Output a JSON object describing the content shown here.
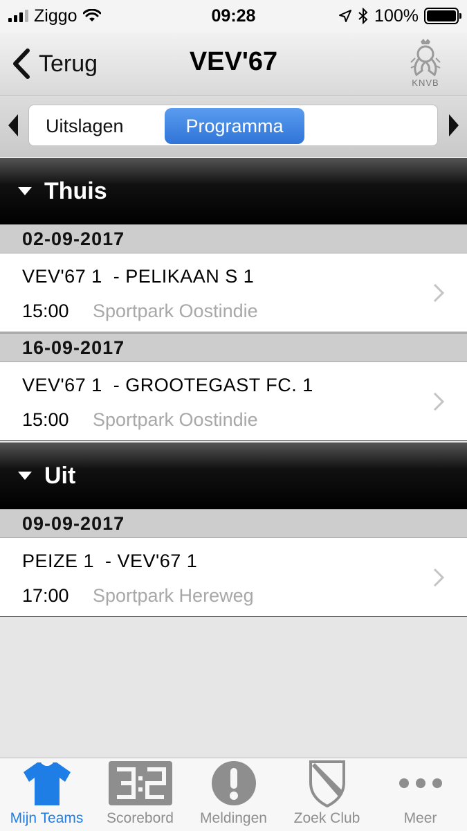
{
  "status": {
    "carrier": "Ziggo",
    "time": "09:28",
    "battery": "100%"
  },
  "nav": {
    "back_label": "Terug",
    "title": "VEV'67",
    "logo_text": "KNVB"
  },
  "segments": {
    "items": [
      "Uitslagen",
      "Programma"
    ],
    "selected": "Programma"
  },
  "sections": [
    {
      "title": "Thuis",
      "groups": [
        {
          "date": "02-09-2017",
          "match": "VEV'67 1  - PELIKAAN S 1",
          "time": "15:00",
          "venue": "Sportpark Oostindie"
        },
        {
          "date": "16-09-2017",
          "match": "VEV'67 1  - GROOTEGAST FC. 1",
          "time": "15:00",
          "venue": "Sportpark Oostindie"
        }
      ]
    },
    {
      "title": "Uit",
      "groups": [
        {
          "date": "09-09-2017",
          "match": "PEIZE 1  - VEV'67 1",
          "time": "17:00",
          "venue": "Sportpark Hereweg"
        }
      ]
    }
  ],
  "tabs": [
    {
      "label": "Mijn Teams",
      "icon": "shirt-icon",
      "active": true
    },
    {
      "label": "Scorebord",
      "icon": "scoreboard-icon"
    },
    {
      "label": "Meldingen",
      "icon": "alert-icon"
    },
    {
      "label": "Zoek Club",
      "icon": "shield-icon"
    },
    {
      "label": "Meer",
      "icon": "more-icon"
    }
  ],
  "colors": {
    "accent": "#1e7ee6",
    "segment_selected": "#3a80e0",
    "venue_text": "#a8a8a8"
  }
}
